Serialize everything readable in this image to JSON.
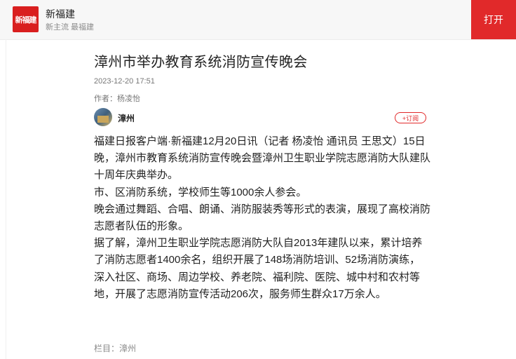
{
  "app": {
    "logo_text": "新福建",
    "name": "新福建",
    "slogan": "新主流 最福建",
    "open_label": "打开"
  },
  "article": {
    "title": "漳州市举办教育系统消防宣传晚会",
    "date": "2023-12-20 17:51",
    "author": "作者：杨凌怡",
    "source_name": "漳州",
    "subscribe_label": "+订阅",
    "paragraphs": [
      "福建日报客户端·新福建12月20日讯（记者 杨凌怡 通讯员 王思文）15日晚，漳州市教育系统消防宣传晚会暨漳州卫生职业学院志愿消防大队建队十周年庆典举办。",
      "市、区消防系统，学校师生等1000余人参会。",
      "晚会通过舞蹈、合唱、朗诵、消防服装秀等形式的表演，展现了高校消防志愿者队伍的形象。",
      "据了解，漳州卫生职业学院志愿消防大队自2013年建队以来，累计培养了消防志愿者1400余名，组织开展了148场消防培训、52场消防演练，深入社区、商场、周边学校、养老院、福利院、医院、城中村和农村等地，开展了志愿消防宣传活动206次，服务师生群众17万余人。"
    ],
    "column_label": "栏目：",
    "column_value": "漳州"
  },
  "colors": {
    "brand_red": "#e1292a"
  }
}
